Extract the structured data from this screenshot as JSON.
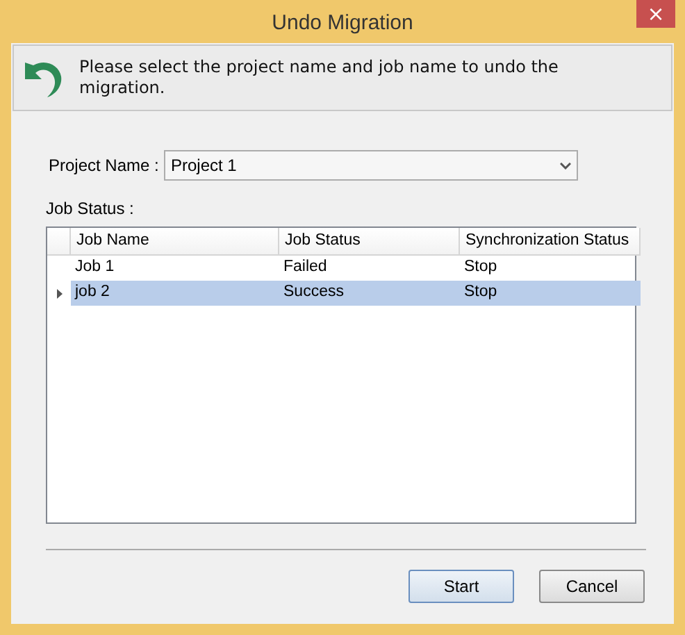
{
  "window": {
    "title": "Undo Migration",
    "close": "×"
  },
  "banner": {
    "message": "Please select the project name and job name to undo the migration."
  },
  "project": {
    "label": "Project Name :",
    "value": "Project 1"
  },
  "job_status": {
    "label": "Job Status :",
    "columns": [
      "Job Name",
      "Job Status",
      "Synchronization Status"
    ],
    "rows": [
      {
        "cells": [
          "Job 1",
          "Failed",
          "Stop"
        ],
        "selected": false
      },
      {
        "cells": [
          "job 2",
          "Success",
          "Stop"
        ],
        "selected": true
      }
    ]
  },
  "buttons": [
    {
      "label": "Start",
      "default": true
    },
    {
      "label": "Cancel",
      "default": false
    }
  ]
}
